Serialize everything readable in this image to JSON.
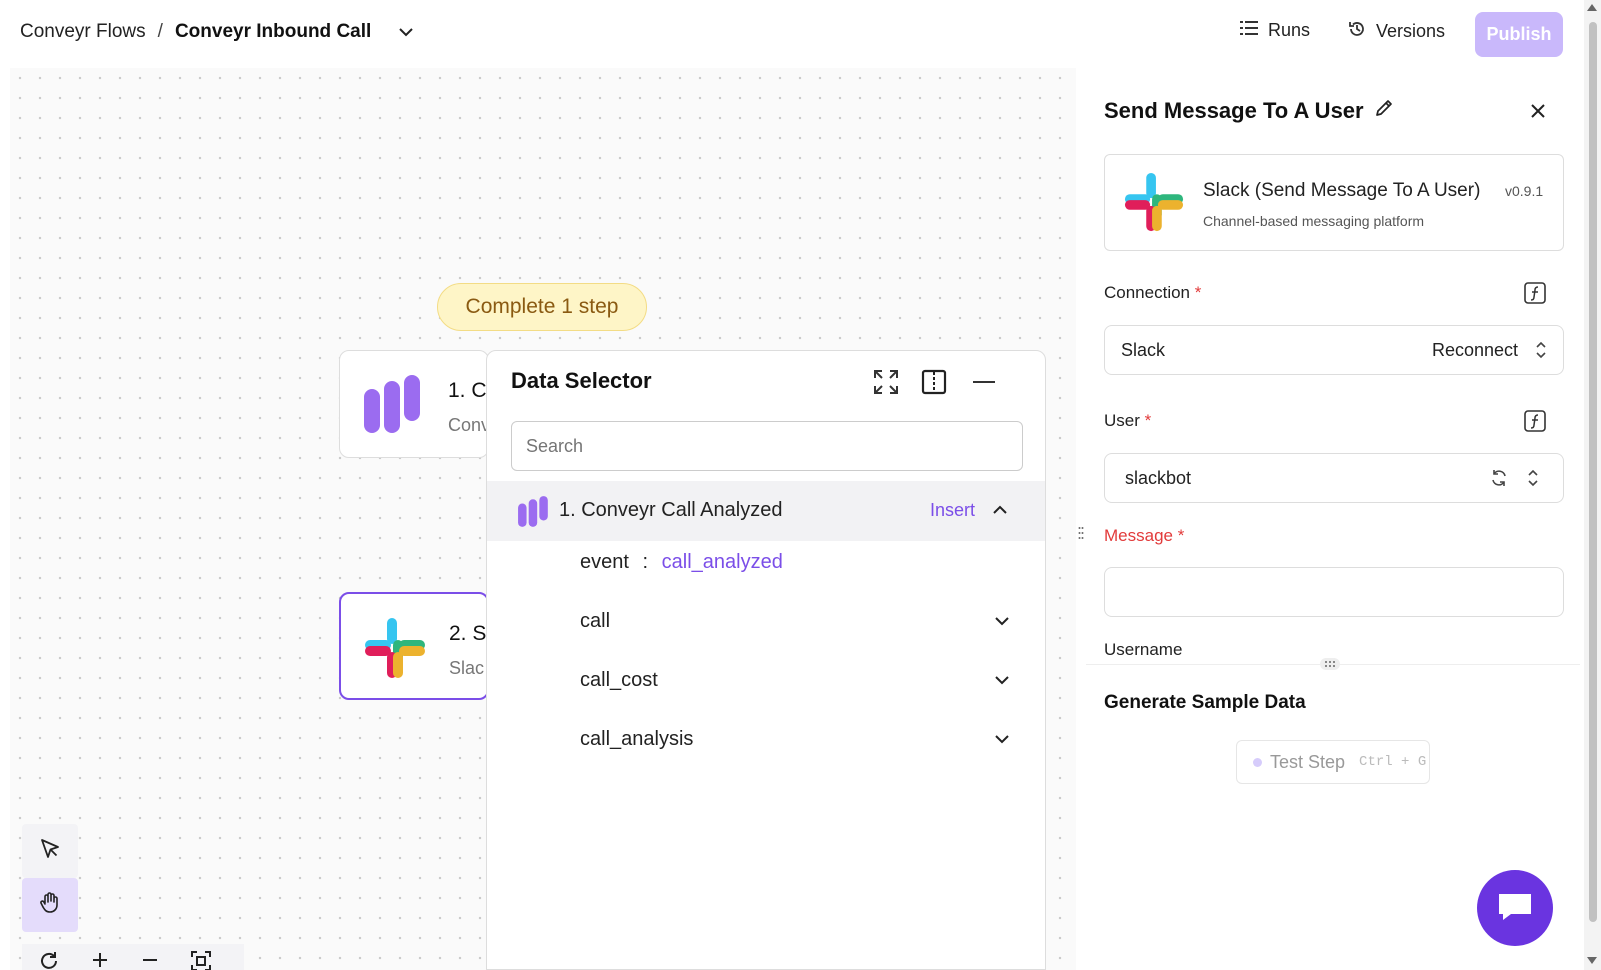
{
  "header": {
    "breadcrumb_parent": "Conveyr Flows",
    "breadcrumb_sep": "/",
    "flow_name": "Conveyr Inbound Call",
    "runs_label": "Runs",
    "versions_label": "Versions",
    "publish_label": "Publish"
  },
  "canvas": {
    "status_pill": "Complete 1 step",
    "steps": [
      {
        "title": "1. C",
        "subtitle": "Conv"
      },
      {
        "title": "2. S",
        "subtitle": "Slac"
      }
    ]
  },
  "data_selector": {
    "title": "Data Selector",
    "search_placeholder": "Search",
    "root": {
      "label": "1. Conveyr Call Analyzed",
      "insert_label": "Insert"
    },
    "items": [
      {
        "key": "event",
        "sep": ":",
        "value": "call_analyzed"
      },
      {
        "key": "call"
      },
      {
        "key": "call_cost"
      },
      {
        "key": "call_analysis"
      }
    ]
  },
  "panel": {
    "title": "Send Message To A User",
    "piece_name": "Slack (Send Message To A User)",
    "piece_version": "v0.9.1",
    "piece_desc": "Channel-based messaging platform",
    "connection_label": "Connection",
    "connection_value": "Slack",
    "reconnect_label": "Reconnect",
    "user_label": "User",
    "user_value": "slackbot",
    "message_label": "Message",
    "required_marker": "*",
    "username_label": "Username",
    "sample_title": "Generate Sample Data",
    "test_label": "Test Step",
    "test_shortcut": "Ctrl + G"
  },
  "colors": {
    "accent": "#7b4ee8",
    "publish_disabled": "#c9b8fb",
    "pill_bg": "#fef5c7",
    "error": "#e23b3b"
  }
}
